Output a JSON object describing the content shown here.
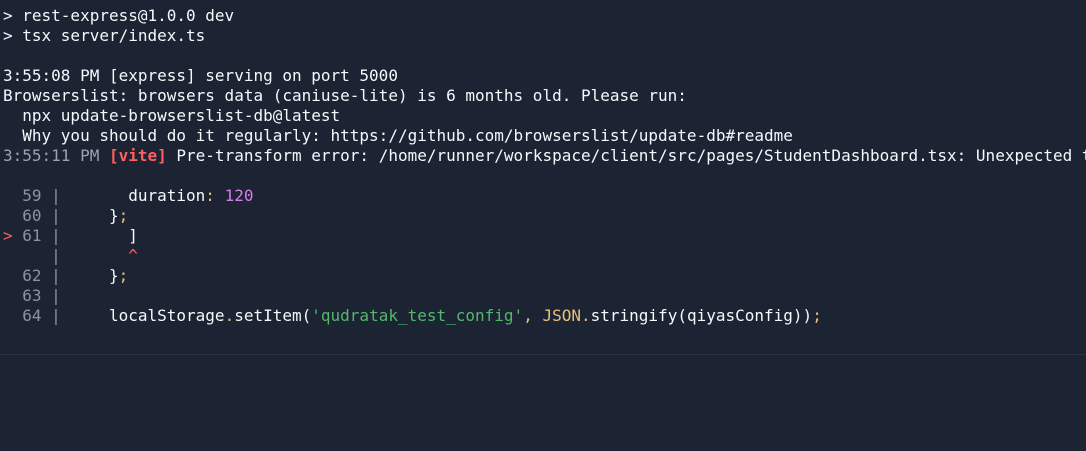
{
  "terminal": {
    "lines": {
      "cmd1": "> rest-express@1.0.0 dev",
      "cmd2": "> tsx server/index.ts",
      "serving": "3:55:08 PM [express] serving on port 5000",
      "browserslist1": "Browserslist: browsers data (caniuse-lite) is 6 months old. Please run:",
      "browserslist2": "  npx update-browserslist-db@latest",
      "browserslist3": "  Why you should do it regularly: https://github.com/browserslist/update-db#readme",
      "err_time": "3:55:11 PM ",
      "err_tag": "[vite]",
      "err_msg": " Pre-transform error: /home/runner/workspace/client/src/pages/StudentDashboard.tsx: Unexpected token"
    },
    "code": {
      "l59_num": "  59 | ",
      "l59_key": "      duration",
      "l59_colon": ": ",
      "l59_val": "120",
      "l60_num": "  60 | ",
      "l60_text": "    }",
      "l60_semi": ";",
      "l61_marker": "> ",
      "l61_num": "61 | ",
      "l61_text": "      ]",
      "caret_num": "     | ",
      "caret_text": "      ^",
      "l62_num": "  62 | ",
      "l62_text": "    }",
      "l62_semi": ";",
      "l63_num": "  63 | ",
      "l64_num": "  64 | ",
      "l64_obj": "    localStorage",
      "l64_dot": ".",
      "l64_method": "setItem(",
      "l64_str": "'qudratak_test_config'",
      "l64_comma": ", ",
      "l64_json": "JSON",
      "l64_dot2": ".",
      "l64_fn": "stringify(qiyasConfig))",
      "l64_semi": ";"
    }
  },
  "colors": {
    "background": "#1c2333",
    "text": "#f5f9fc",
    "error": "#ff5f5f",
    "number": "#d67ee8",
    "string": "#54b86c",
    "punctuation": "#e6c07b"
  }
}
